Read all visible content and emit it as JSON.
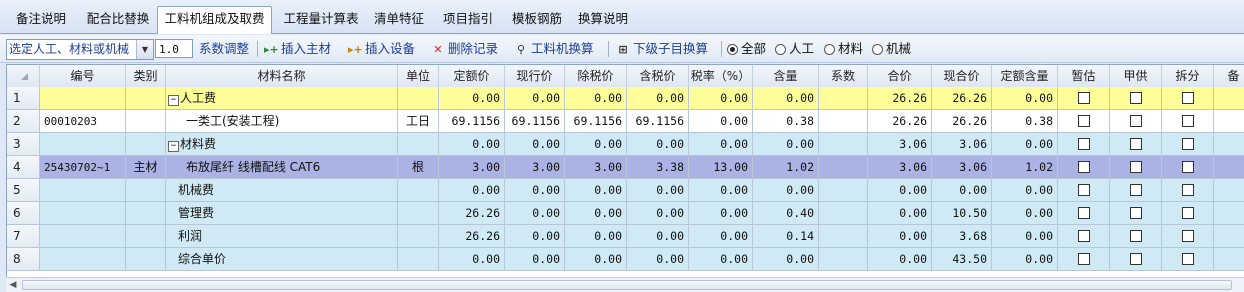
{
  "tabs": [
    "备注说明",
    "配合比替换",
    "工料机组成及取费",
    "工程量计算表",
    "清单特征",
    "项目指引",
    "模板钢筋",
    "换算说明"
  ],
  "active_tab": 2,
  "toolbar": {
    "select_value": "选定人工、材料或机械",
    "coef_value": "1.0",
    "coef_label": "系数调整",
    "insert_main": "插入主材",
    "insert_equip": "插入设备",
    "delete_record": "删除记录",
    "swap_glj": "工料机换算",
    "child_swap": "下级子目换算",
    "radio_all": "全部",
    "radio_labor": "人工",
    "radio_material": "材料",
    "radio_machine": "机械"
  },
  "columns": [
    "编号",
    "类别",
    "材料名称",
    "单位",
    "定额价",
    "现行价",
    "除税价",
    "含税价",
    "税率（%）",
    "含量",
    "系数",
    "合价",
    "现合价",
    "定额含量",
    "暂估",
    "甲供",
    "拆分",
    "备"
  ],
  "rows": [
    {
      "idx": "1",
      "code": "",
      "type": "",
      "name": "人工费",
      "expand": "−",
      "unit": "",
      "p1": "0.00",
      "p2": "0.00",
      "p3": "0.00",
      "p4": "0.00",
      "tax": "0.00",
      "qty": "0.00",
      "coef": "",
      "sum": "26.26",
      "cur": "26.26",
      "dq": "0.00",
      "style": "yellow"
    },
    {
      "idx": "2",
      "code": "00010203",
      "type": "",
      "name": "一类工(安装工程)",
      "expand": "",
      "unit": "工日",
      "p1": "69.1156",
      "p2": "69.1156",
      "p3": "69.1156",
      "p4": "69.1156",
      "tax": "0.00",
      "qty": "0.38",
      "coef": "",
      "sum": "26.26",
      "cur": "26.26",
      "dq": "0.38",
      "style": "white"
    },
    {
      "idx": "3",
      "code": "",
      "type": "",
      "name": "材料费",
      "expand": "−",
      "unit": "",
      "p1": "0.00",
      "p2": "0.00",
      "p3": "0.00",
      "p4": "0.00",
      "tax": "0.00",
      "qty": "0.00",
      "coef": "",
      "sum": "3.06",
      "cur": "3.06",
      "dq": "0.00",
      "style": "blue"
    },
    {
      "idx": "4",
      "code": "25430702~1",
      "type": "主材",
      "name": "布放尾纤 线槽配线 CAT6",
      "expand": "",
      "unit": "根",
      "p1": "3.00",
      "p2": "3.00",
      "p3": "3.00",
      "p4": "3.38",
      "tax": "13.00",
      "qty": "1.02",
      "coef": "",
      "sum": "3.06",
      "cur": "3.06",
      "dq": "1.02",
      "style": "selected"
    },
    {
      "idx": "5",
      "code": "",
      "type": "",
      "name": "机械费",
      "expand": "",
      "unit": "",
      "p1": "0.00",
      "p2": "0.00",
      "p3": "0.00",
      "p4": "0.00",
      "tax": "0.00",
      "qty": "0.00",
      "coef": "",
      "sum": "0.00",
      "cur": "0.00",
      "dq": "0.00",
      "style": "blue"
    },
    {
      "idx": "6",
      "code": "",
      "type": "",
      "name": "管理费",
      "expand": "",
      "unit": "",
      "p1": "26.26",
      "p2": "0.00",
      "p3": "0.00",
      "p4": "0.00",
      "tax": "0.00",
      "qty": "0.40",
      "coef": "",
      "sum": "0.00",
      "cur": "10.50",
      "dq": "0.00",
      "style": "blue"
    },
    {
      "idx": "7",
      "code": "",
      "type": "",
      "name": "利润",
      "expand": "",
      "unit": "",
      "p1": "26.26",
      "p2": "0.00",
      "p3": "0.00",
      "p4": "0.00",
      "tax": "0.00",
      "qty": "0.14",
      "coef": "",
      "sum": "0.00",
      "cur": "3.68",
      "dq": "0.00",
      "style": "blue"
    },
    {
      "idx": "8",
      "code": "",
      "type": "",
      "name": "综合单价",
      "expand": "",
      "unit": "",
      "p1": "0.00",
      "p2": "0.00",
      "p3": "0.00",
      "p4": "0.00",
      "tax": "0.00",
      "qty": "0.00",
      "coef": "",
      "sum": "0.00",
      "cur": "43.50",
      "dq": "0.00",
      "style": "blue"
    }
  ]
}
